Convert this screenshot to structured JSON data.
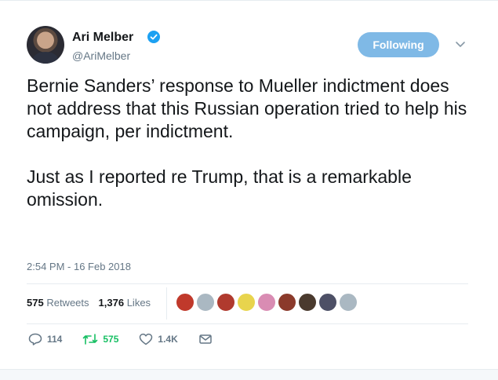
{
  "tweet": {
    "author": {
      "display_name": "Ari Melber",
      "handle": "@AriMelber",
      "verified": true
    },
    "follow_button_label": "Following",
    "text": "Bernie Sanders’ response to Mueller indictment does not address that this Russian operation tried to help his campaign, per indictment.\n\nJust as I reported re Trump, that is a remarkable omission.",
    "timestamp": "2:54 PM - 16 Feb 2018",
    "stats": {
      "retweets_count": "575",
      "retweets_label": "Retweets",
      "likes_count": "1,376",
      "likes_label": "Likes"
    },
    "retweeter_avatars": [
      {
        "color": "#c0392b"
      },
      {
        "color": "#aab8c2"
      },
      {
        "color": "#b03a2e"
      },
      {
        "color": "#e8d44d"
      },
      {
        "color": "#d98cb3"
      },
      {
        "color": "#8b3a2b"
      },
      {
        "color": "#4a3a2e"
      },
      {
        "color": "#4d5066"
      },
      {
        "color": "#aab8c2"
      }
    ],
    "actions": {
      "reply_count": "114",
      "retweet_count": "575",
      "like_count": "1.4K"
    },
    "colors": {
      "accent": "#1da1f2",
      "follow_button": "#7fb9e6",
      "retweet_active": "#17bf63",
      "secondary_text": "#657786"
    }
  }
}
